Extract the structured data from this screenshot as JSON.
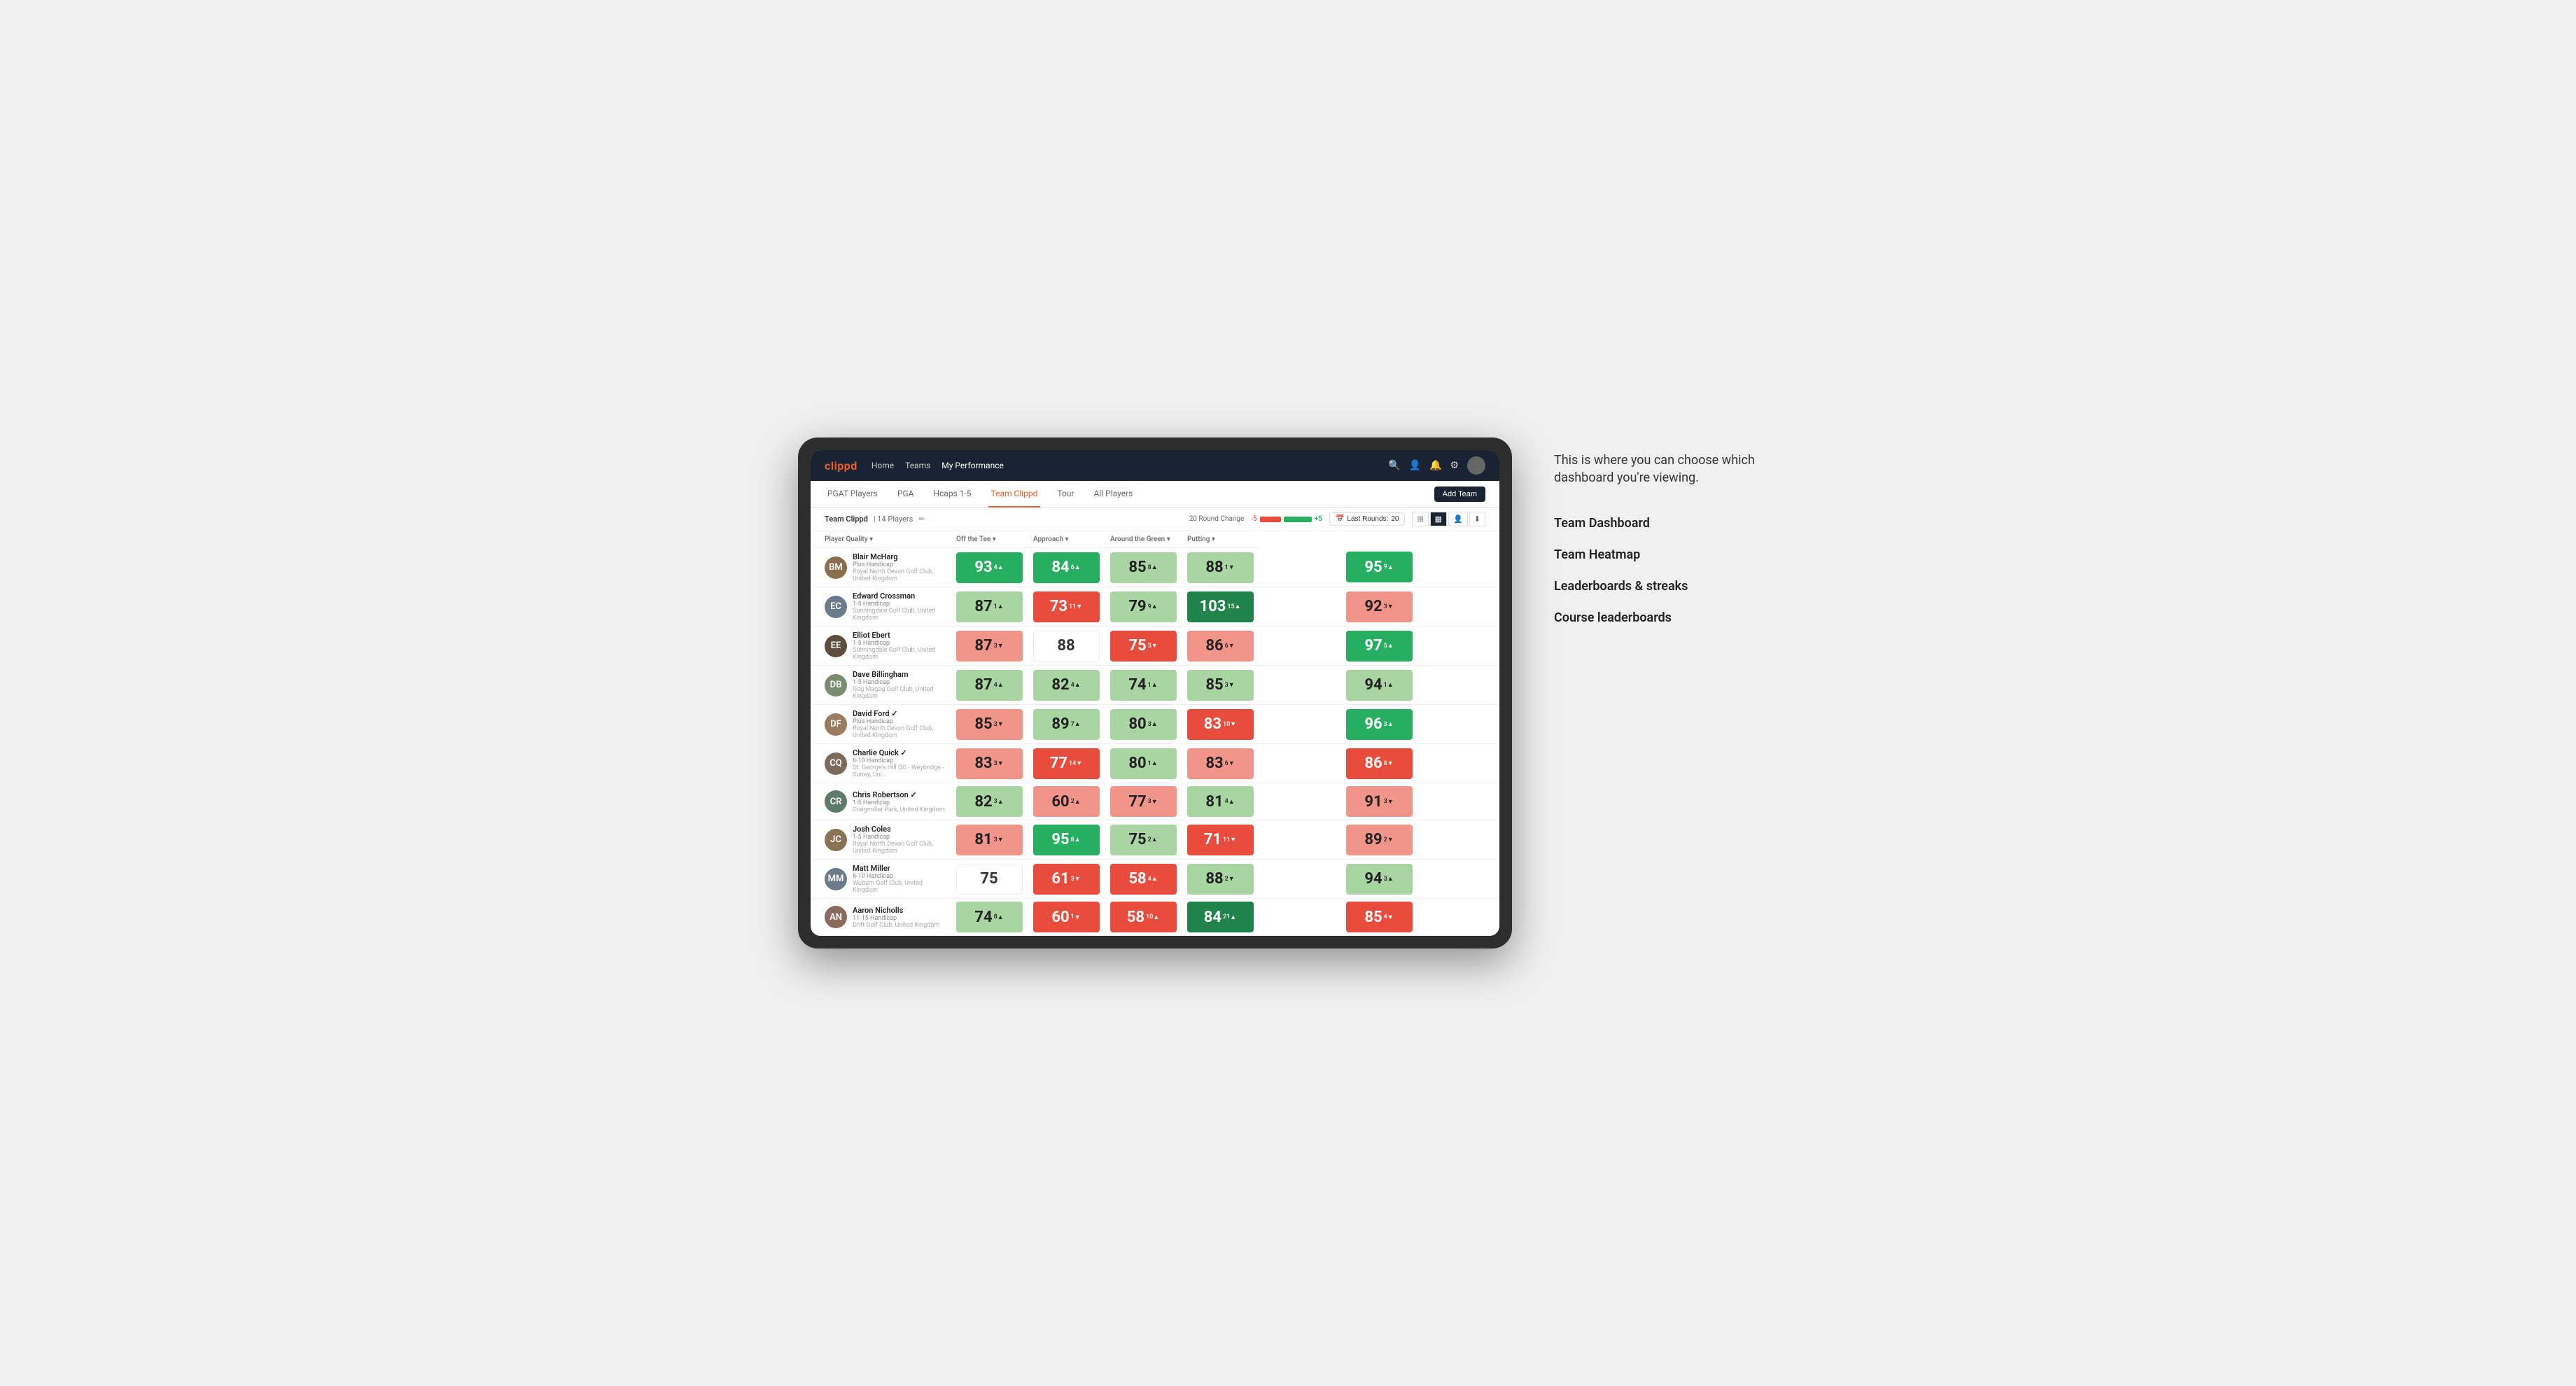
{
  "page": {
    "background": "#f0f0f0"
  },
  "annotation": {
    "callout": "This is where you can choose which dashboard you're viewing.",
    "items": [
      "Team Dashboard",
      "Team Heatmap",
      "Leaderboards & streaks",
      "Course leaderboards"
    ]
  },
  "nav": {
    "logo": "clippd",
    "links": [
      {
        "label": "Home",
        "active": false
      },
      {
        "label": "Teams",
        "active": false
      },
      {
        "label": "My Performance",
        "active": true
      }
    ],
    "add_team_label": "Add Team"
  },
  "sub_nav": {
    "links": [
      {
        "label": "PGAT Players",
        "active": false
      },
      {
        "label": "PGA",
        "active": false
      },
      {
        "label": "Hcaps 1-5",
        "active": false
      },
      {
        "label": "Team Clippd",
        "active": true
      },
      {
        "label": "Tour",
        "active": false
      },
      {
        "label": "All Players",
        "active": false
      }
    ]
  },
  "team_header": {
    "name": "Team Clippd",
    "separator": "|",
    "count": "14 Players",
    "round_change_label": "20 Round Change",
    "bar_neg": "-5",
    "bar_pos": "+5",
    "last_rounds_label": "Last Rounds:",
    "last_rounds_value": "20",
    "view_options": [
      "grid",
      "heatmap",
      "chart",
      "download"
    ]
  },
  "table": {
    "headers": [
      {
        "label": "Player Quality ▾",
        "key": "player_quality"
      },
      {
        "label": "Off the Tee ▾",
        "key": "off_tee"
      },
      {
        "label": "Approach ▾",
        "key": "approach"
      },
      {
        "label": "Around the Green ▾",
        "key": "around_green"
      },
      {
        "label": "Putting ▾",
        "key": "putting"
      }
    ],
    "players": [
      {
        "name": "Blair McHarg",
        "handicap": "Plus Handicap",
        "club": "Royal North Devon Golf Club, United Kingdom",
        "avatar_color": "#8B6E4E",
        "avatar_initials": "BM",
        "scores": [
          {
            "value": 93,
            "change": 4,
            "dir": "up",
            "color": "green"
          },
          {
            "value": 84,
            "change": 6,
            "dir": "up",
            "color": "green"
          },
          {
            "value": 85,
            "change": 8,
            "dir": "up",
            "color": "light-green"
          },
          {
            "value": 88,
            "change": 1,
            "dir": "down",
            "color": "light-green"
          },
          {
            "value": 95,
            "change": 9,
            "dir": "up",
            "color": "green"
          }
        ]
      },
      {
        "name": "Edward Crossman",
        "handicap": "1-5 Handicap",
        "club": "Sunningdale Golf Club, United Kingdom",
        "avatar_color": "#6B7B8D",
        "avatar_initials": "EC",
        "scores": [
          {
            "value": 87,
            "change": 1,
            "dir": "up",
            "color": "light-green"
          },
          {
            "value": 73,
            "change": 11,
            "dir": "down",
            "color": "red"
          },
          {
            "value": 79,
            "change": 9,
            "dir": "up",
            "color": "light-green"
          },
          {
            "value": 103,
            "change": 15,
            "dir": "up",
            "color": "dark-green"
          },
          {
            "value": 92,
            "change": 3,
            "dir": "down",
            "color": "light-red"
          }
        ]
      },
      {
        "name": "Elliot Ebert",
        "handicap": "1-5 Handicap",
        "club": "Sunningdale Golf Club, United Kingdom",
        "avatar_color": "#5D4E3C",
        "avatar_initials": "EE",
        "scores": [
          {
            "value": 87,
            "change": 3,
            "dir": "down",
            "color": "light-red"
          },
          {
            "value": 88,
            "change": null,
            "dir": null,
            "color": "white"
          },
          {
            "value": 75,
            "change": 3,
            "dir": "down",
            "color": "red"
          },
          {
            "value": 86,
            "change": 6,
            "dir": "down",
            "color": "light-red"
          },
          {
            "value": 97,
            "change": 5,
            "dir": "up",
            "color": "green"
          }
        ]
      },
      {
        "name": "Dave Billingham",
        "handicap": "1-5 Handicap",
        "club": "Gog Magog Golf Club, United Kingdom",
        "avatar_color": "#7A8C6E",
        "avatar_initials": "DB",
        "scores": [
          {
            "value": 87,
            "change": 4,
            "dir": "up",
            "color": "light-green"
          },
          {
            "value": 82,
            "change": 4,
            "dir": "up",
            "color": "light-green"
          },
          {
            "value": 74,
            "change": 1,
            "dir": "up",
            "color": "light-green"
          },
          {
            "value": 85,
            "change": 3,
            "dir": "down",
            "color": "light-green"
          },
          {
            "value": 94,
            "change": 1,
            "dir": "up",
            "color": "light-green"
          }
        ]
      },
      {
        "name": "David Ford ✓",
        "handicap": "Plus Handicap",
        "club": "Royal North Devon Golf Club, United Kingdom",
        "avatar_color": "#9B7B5E",
        "avatar_initials": "DF",
        "scores": [
          {
            "value": 85,
            "change": 3,
            "dir": "down",
            "color": "light-red"
          },
          {
            "value": 89,
            "change": 7,
            "dir": "up",
            "color": "light-green"
          },
          {
            "value": 80,
            "change": 3,
            "dir": "up",
            "color": "light-green"
          },
          {
            "value": 83,
            "change": 10,
            "dir": "down",
            "color": "red"
          },
          {
            "value": 96,
            "change": 3,
            "dir": "up",
            "color": "green"
          }
        ]
      },
      {
        "name": "Charlie Quick ✓",
        "handicap": "6-10 Handicap",
        "club": "St. George's Hill GC - Weybridge - Surrey, Uni...",
        "avatar_color": "#7B6B5A",
        "avatar_initials": "CQ",
        "scores": [
          {
            "value": 83,
            "change": 3,
            "dir": "down",
            "color": "light-red"
          },
          {
            "value": 77,
            "change": 14,
            "dir": "down",
            "color": "red"
          },
          {
            "value": 80,
            "change": 1,
            "dir": "up",
            "color": "light-green"
          },
          {
            "value": 83,
            "change": 6,
            "dir": "down",
            "color": "light-red"
          },
          {
            "value": 86,
            "change": 8,
            "dir": "down",
            "color": "red"
          }
        ]
      },
      {
        "name": "Chris Robertson ✓",
        "handicap": "1-5 Handicap",
        "club": "Craigmillar Park, United Kingdom",
        "avatar_color": "#5E7A6A",
        "avatar_initials": "CR",
        "scores": [
          {
            "value": 82,
            "change": 3,
            "dir": "up",
            "color": "light-green"
          },
          {
            "value": 60,
            "change": 2,
            "dir": "up",
            "color": "light-red"
          },
          {
            "value": 77,
            "change": 3,
            "dir": "down",
            "color": "light-red"
          },
          {
            "value": 81,
            "change": 4,
            "dir": "up",
            "color": "light-green"
          },
          {
            "value": 91,
            "change": 3,
            "dir": "down",
            "color": "light-red"
          }
        ]
      },
      {
        "name": "Josh Coles",
        "handicap": "1-5 Handicap",
        "club": "Royal North Devon Golf Club, United Kingdom",
        "avatar_color": "#8B7355",
        "avatar_initials": "JC",
        "scores": [
          {
            "value": 81,
            "change": 3,
            "dir": "down",
            "color": "light-red"
          },
          {
            "value": 95,
            "change": 8,
            "dir": "up",
            "color": "green"
          },
          {
            "value": 75,
            "change": 2,
            "dir": "up",
            "color": "light-green"
          },
          {
            "value": 71,
            "change": 11,
            "dir": "down",
            "color": "red"
          },
          {
            "value": 89,
            "change": 2,
            "dir": "down",
            "color": "light-red"
          }
        ]
      },
      {
        "name": "Matt Miller",
        "handicap": "6-10 Handicap",
        "club": "Woburn Golf Club, United Kingdom",
        "avatar_color": "#6B7B8A",
        "avatar_initials": "MM",
        "scores": [
          {
            "value": 75,
            "change": null,
            "dir": null,
            "color": "white"
          },
          {
            "value": 61,
            "change": 3,
            "dir": "down",
            "color": "red"
          },
          {
            "value": 58,
            "change": 4,
            "dir": "up",
            "color": "red"
          },
          {
            "value": 88,
            "change": 2,
            "dir": "down",
            "color": "light-green"
          },
          {
            "value": 94,
            "change": 3,
            "dir": "up",
            "color": "light-green"
          }
        ]
      },
      {
        "name": "Aaron Nicholls",
        "handicap": "11-15 Handicap",
        "club": "Drift Golf Club, United Kingdom",
        "avatar_color": "#8B6B5E",
        "avatar_initials": "AN",
        "scores": [
          {
            "value": 74,
            "change": 8,
            "dir": "up",
            "color": "light-green"
          },
          {
            "value": 60,
            "change": 1,
            "dir": "down",
            "color": "red"
          },
          {
            "value": 58,
            "change": 10,
            "dir": "up",
            "color": "red"
          },
          {
            "value": 84,
            "change": 21,
            "dir": "up",
            "color": "dark-green"
          },
          {
            "value": 85,
            "change": 4,
            "dir": "down",
            "color": "red"
          }
        ]
      }
    ]
  }
}
